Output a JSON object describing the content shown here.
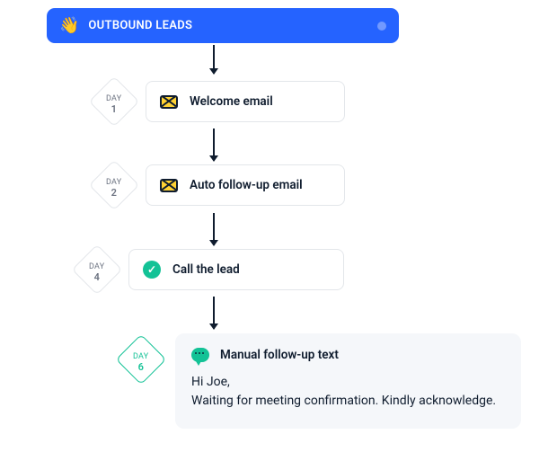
{
  "header": {
    "emoji": "👋",
    "title": "OUTBOUND LEADS"
  },
  "steps": [
    {
      "day_label": "DAY",
      "day_num": "1",
      "title": "Welcome email"
    },
    {
      "day_label": "DAY",
      "day_num": "2",
      "title": "Auto follow-up email"
    },
    {
      "day_label": "DAY",
      "day_num": "4",
      "title": "Call the lead"
    },
    {
      "day_label": "DAY",
      "day_num": "6",
      "title": "Manual follow-up text"
    }
  ],
  "detail": {
    "line1": "Hi Joe,",
    "line2": "Waiting for meeting confirmation. Kindly acknowledge."
  }
}
